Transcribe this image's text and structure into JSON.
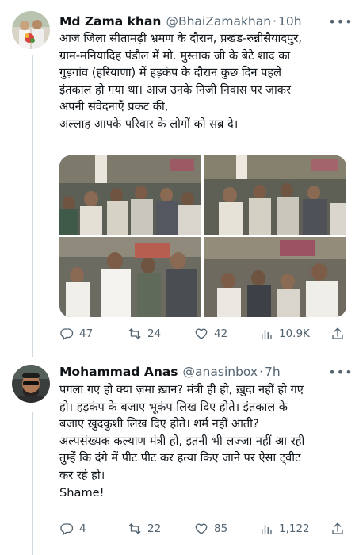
{
  "tweets": [
    {
      "author_name": "Md Zama khan",
      "handle": "@BhaiZamakhan",
      "separator": "·",
      "time": "10h",
      "text_lines": [
        "आज जिला सीतामढ़ी भ्रमण के दौरान, प्रखंड-रुन्नीसैयादपुर,",
        "ग्राम-मनियादिह पंडौल में मो. मुस्ताक जी के बेटे शाद का",
        "गुड़गांव (हरियाणा) में हड़कंप के दौरान कुछ दिन पहले",
        "इंतकाल हो गया था। आज उनके निजी निवास पर जाकर",
        "अपनी संवेदनाएँ प्रकट की,",
        "अल्लाह आपके परिवार के लोगों को सब्र दे।"
      ],
      "stats": {
        "replies": "47",
        "retweets": "24",
        "likes": "42",
        "views": "10.9K"
      }
    },
    {
      "author_name": "Mohammad Anas",
      "handle": "@anasinbox",
      "separator": "·",
      "time": "7h",
      "text_lines": [
        "पगला गए हो क्या ज़मा ख़ान? मंत्री ही हो, ख़ुदा नहीं हो गए",
        "हो।  हड़कंप के बजाए भूकंप लिख दिए होते। इंतकाल के",
        "बजाए ख़ुदकुशी लिख दिए होते। शर्म नहीं आती?",
        "अल्पसंख्यक कल्याण मंत्री हो, इतनी भी लज्जा नहीं आ रही",
        "तुम्हें कि दंगे में पीट पीट कर हत्या किए जाने पर ऐसा ट्वीट",
        "कर रहे हो।",
        "Shame!"
      ],
      "stats": {
        "replies": "4",
        "retweets": "22",
        "likes": "85",
        "views": "1,122"
      }
    }
  ],
  "colors": {
    "text": "#0f1419",
    "secondary": "#536471",
    "thread_line": "#cfd9de"
  },
  "icons": [
    "more-icon",
    "reply-icon",
    "retweet-icon",
    "like-icon",
    "views-icon",
    "share-icon"
  ]
}
